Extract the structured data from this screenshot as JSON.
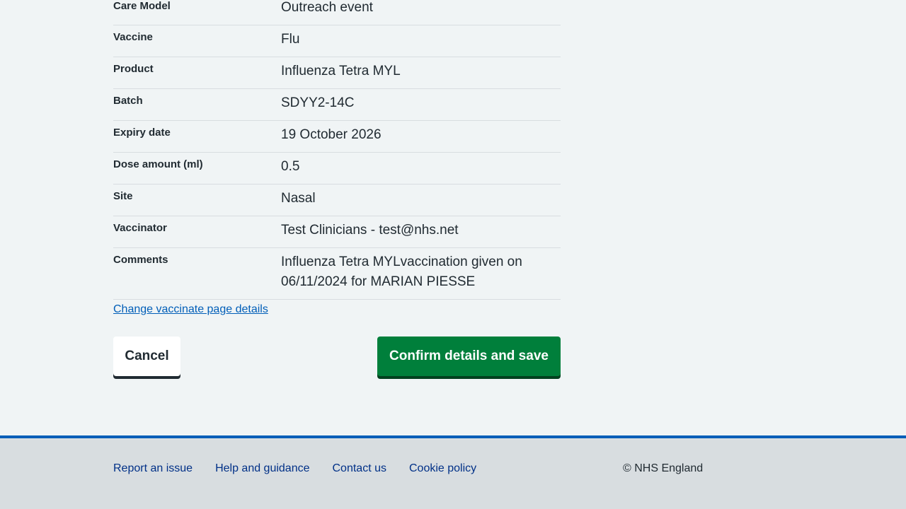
{
  "summary": [
    {
      "key": "Care Model",
      "value": "Outreach event"
    },
    {
      "key": "Vaccine",
      "value": "Flu"
    },
    {
      "key": "Product",
      "value": "Influenza Tetra MYL"
    },
    {
      "key": "Batch",
      "value": "SDYY2-14C"
    },
    {
      "key": "Expiry date",
      "value": "19 October 2026"
    },
    {
      "key": "Dose amount (ml)",
      "value": "0.5"
    },
    {
      "key": "Site",
      "value": "Nasal"
    },
    {
      "key": "Vaccinator",
      "value": "Test Clinicians - test@nhs.net"
    },
    {
      "key": "Comments",
      "value": "Influenza Tetra MYLvaccination given on 06/11/2024 for MARIAN PIESSE"
    }
  ],
  "change_link": "Change vaccinate page details",
  "buttons": {
    "cancel": "Cancel",
    "confirm": "Confirm details and save"
  },
  "footer": {
    "links": [
      "Report an issue",
      "Help and guidance",
      "Contact us",
      "Cookie policy"
    ],
    "copyright": "© NHS England"
  },
  "colors": {
    "background": "#f0f4f5",
    "link": "#005eb8",
    "primary_button": "#007f3b",
    "footer_bg": "#d8dde0",
    "footer_border": "#005eb8"
  }
}
